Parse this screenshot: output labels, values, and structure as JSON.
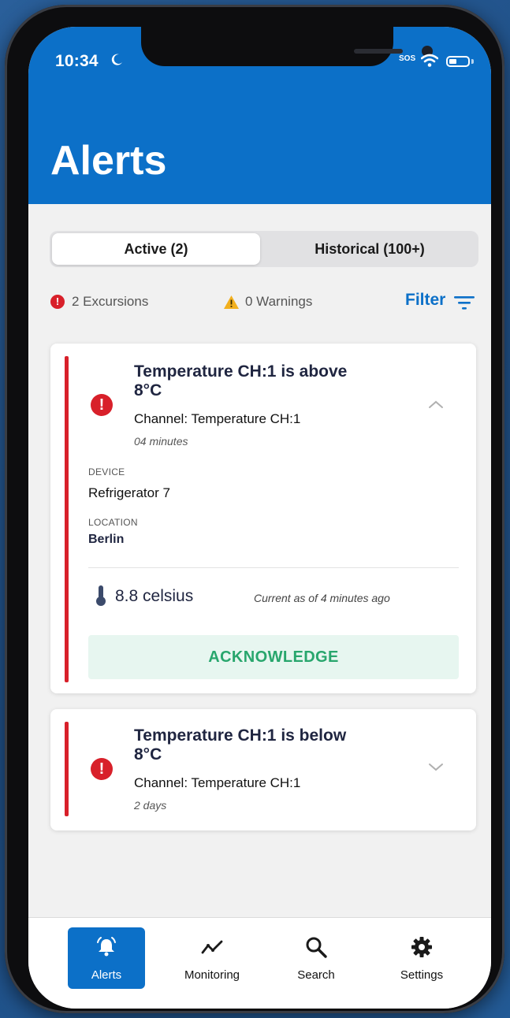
{
  "status_bar": {
    "time": "10:34",
    "sos": "SOS"
  },
  "header": {
    "title": "Alerts"
  },
  "segments": {
    "active": "Active (2)",
    "historical": "Historical (100+)"
  },
  "summary": {
    "excursions": "2 Excursions",
    "warnings": "0 Warnings",
    "filter": "Filter"
  },
  "alerts": [
    {
      "title": "Temperature CH:1 is above\n 8°C",
      "channel": "Channel: Temperature CH:1",
      "time": "04 minutes",
      "device_label": "DEVICE",
      "device": "Refrigerator 7",
      "location_label": "LOCATION",
      "location": "Berlin",
      "reading": "8.8 celsius",
      "current_as_of": "Current as of 4 minutes ago",
      "acknowledge": "ACKNOWLEDGE",
      "expanded": true
    },
    {
      "title": "Temperature CH:1 is below\n8°C",
      "channel": "Channel: Temperature CH:1",
      "time": "2 days",
      "expanded": false
    }
  ],
  "tabbar": {
    "items": [
      {
        "label": "Alerts",
        "icon": "bell-icon",
        "active": true
      },
      {
        "label": "Monitoring",
        "icon": "trend-line-icon",
        "active": false
      },
      {
        "label": "Search",
        "icon": "search-icon",
        "active": false
      },
      {
        "label": "Settings",
        "icon": "gear-icon",
        "active": false
      }
    ]
  },
  "colors": {
    "primary": "#0c70c8",
    "alert_red": "#d8202a",
    "ack_green": "#28a66d",
    "warning_yellow": "#f2b01e"
  }
}
